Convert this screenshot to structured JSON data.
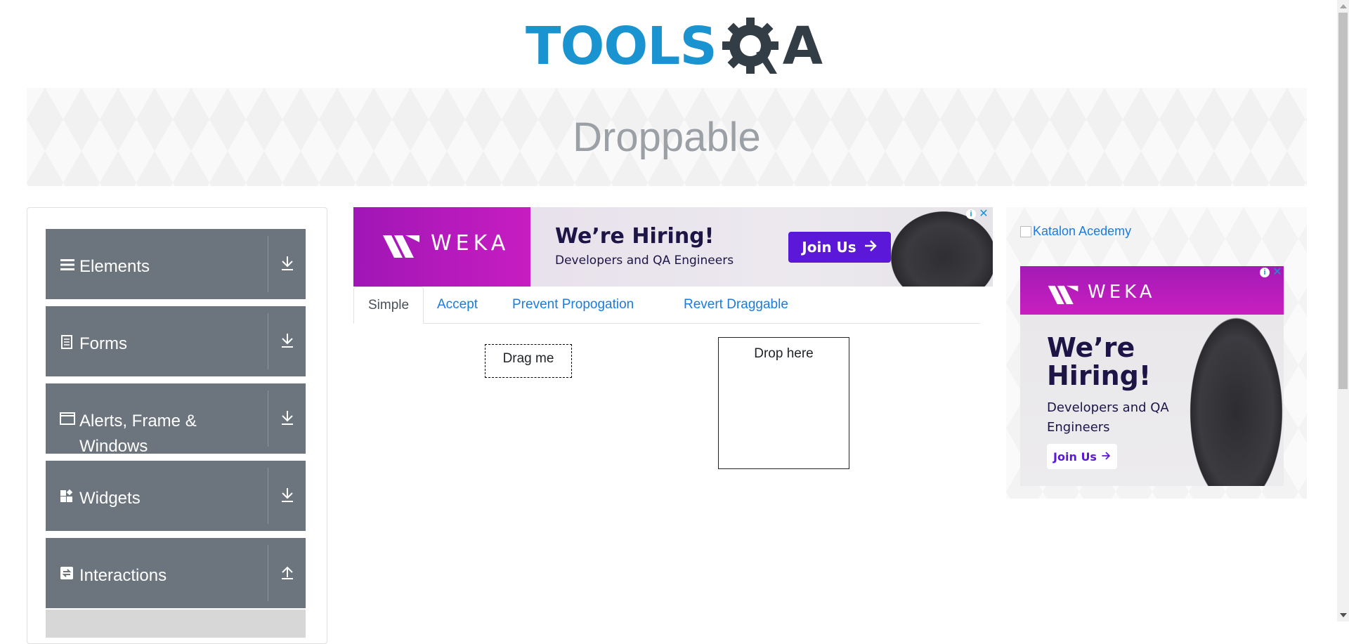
{
  "header": {
    "logo_text_tools": "TOOLS",
    "logo_text_qa": "A",
    "page_title": "Droppable"
  },
  "left_menu": {
    "groups": [
      {
        "label": "Elements",
        "icon": "menu-lines-icon",
        "arrow": "download-arrow-icon"
      },
      {
        "label": "Forms",
        "icon": "document-icon",
        "arrow": "download-arrow-icon"
      },
      {
        "label": "Alerts, Frame & Windows",
        "icon": "window-icon",
        "arrow": "download-arrow-icon"
      },
      {
        "label": "Widgets",
        "icon": "widgets-icon",
        "arrow": "download-arrow-icon"
      },
      {
        "label": "Interactions",
        "icon": "interactions-icon",
        "arrow": "upload-arrow-icon"
      }
    ]
  },
  "ad_top": {
    "brand": "WEKA",
    "headline": "We’re Hiring!",
    "subline": "Developers and QA Engineers",
    "cta": "Join Us"
  },
  "tabs": [
    {
      "label": "Simple",
      "active": true
    },
    {
      "label": "Accept",
      "active": false
    },
    {
      "label": "Prevent Propogation",
      "active": false
    },
    {
      "label": "Revert Draggable",
      "active": false
    }
  ],
  "simple": {
    "draggable_label": "Drag me",
    "droppable_label": "Drop here"
  },
  "right_ad": {
    "image_alt": "Katalon Acedemy",
    "brand": "WEKA",
    "headline": "We’re Hiring!",
    "subline": "Developers and QA Engineers",
    "cta": "Join Us"
  },
  "colors": {
    "logo_blue": "#1a94d0",
    "menu_gray": "#6c757d",
    "link_blue": "#1a7ce0",
    "weka_purple": "#a016b6",
    "cta_purple": "#5b18d9"
  }
}
